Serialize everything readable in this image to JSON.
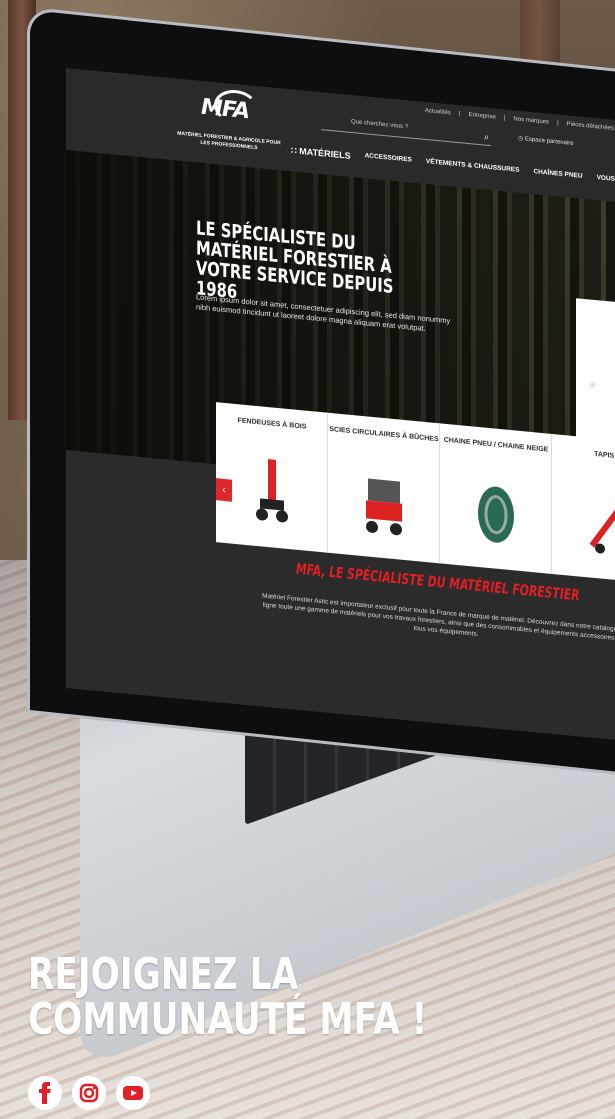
{
  "site": {
    "top_links": [
      "Actualités",
      "|",
      "Entreprise",
      "|",
      "Nos marques",
      "|",
      "Pièces détachées"
    ],
    "logo": "MFA",
    "tagline": "MATÉRIEL FORESTIER & AGRICOLE POUR LES PROFESSIONNELS",
    "search_placeholder": "Que cherchez-vous ?",
    "account_label": "Espace partenaire",
    "nav": [
      "MATÉRIELS",
      "ACCESSOIRES",
      "VÊTEMENTS & CHAUSSURES",
      "CHAÎNES PNEU",
      "VOUS SOUHAITEZ ?"
    ],
    "hero": {
      "title": "LE SPÉCIALISTE DU MATÉRIEL FORESTIER À VOTRE SERVICE DEPUIS 1986",
      "text": "Lorem ipsum dolor sit amet, consectetuer adipiscing elit, sed diam nonummy nibh euismod tincidunt ut laoreet dolore magna aliquam erat volutpat."
    },
    "categories": [
      {
        "label": "FENDEUSES À BOIS"
      },
      {
        "label": "SCIES CIRCULAIRES À BÛCHES"
      },
      {
        "label": "CHAINE PNEU / CHAINE NEIGE"
      },
      {
        "label": "TAPIS M"
      }
    ],
    "band": {
      "title": "MFA, LE SPÉCIALISTE DU MATÉRIEL FORESTIER",
      "text": "Matériel Forestier Astic est importateur exclusif pour toute la France de marque de matériel. Découvrez dans notre catalogue en ligne toute une gamme de matériels pour vos travaux forestiers, ainsi que des consommables et équipements accessoires pour tous vos équipements."
    }
  },
  "caption": {
    "line1": "REJOIGNEZ LA",
    "line2": "COMMUNAUTÉ MFA !"
  },
  "socials": [
    {
      "icon": "facebook-icon"
    },
    {
      "icon": "instagram-icon"
    },
    {
      "icon": "youtube-icon"
    }
  ],
  "colors": {
    "accent": "#e31e24",
    "dark": "#2a2a2b"
  }
}
